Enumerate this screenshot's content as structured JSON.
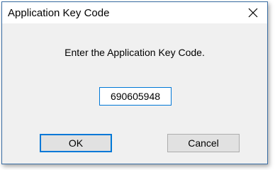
{
  "window": {
    "title": "Application Key Code",
    "close_icon": "close-icon"
  },
  "dialog": {
    "prompt": "Enter the Application Key Code.",
    "key_code_value": "690605948",
    "ok_label": "OK",
    "cancel_label": "Cancel"
  },
  "colors": {
    "accent": "#0078d7",
    "dialog_bg": "#f0f0f0",
    "button_bg": "#e1e1e1"
  }
}
